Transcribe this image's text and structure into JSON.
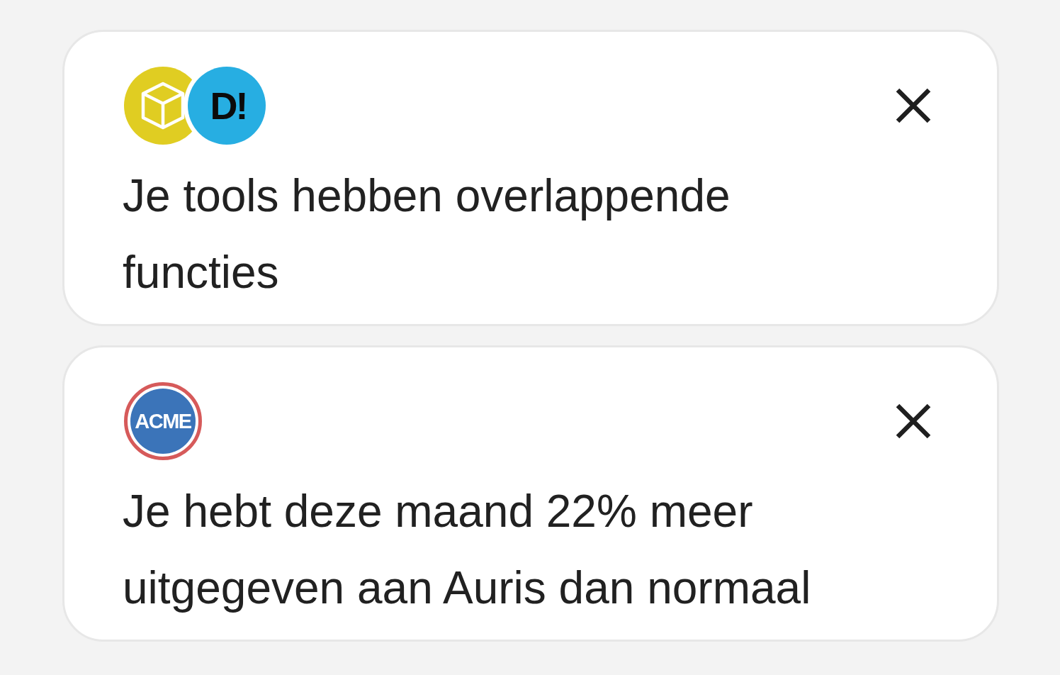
{
  "notifications": [
    {
      "logos": [
        {
          "kind": "cube"
        },
        {
          "kind": "wordmark",
          "text": "D!"
        }
      ],
      "message": "Je tools hebben overlappende functies"
    },
    {
      "logos": [
        {
          "kind": "seal",
          "text": "ACME"
        }
      ],
      "message": "Je hebt deze maand 22% meer uitgegeven aan Auris dan normaal"
    }
  ]
}
